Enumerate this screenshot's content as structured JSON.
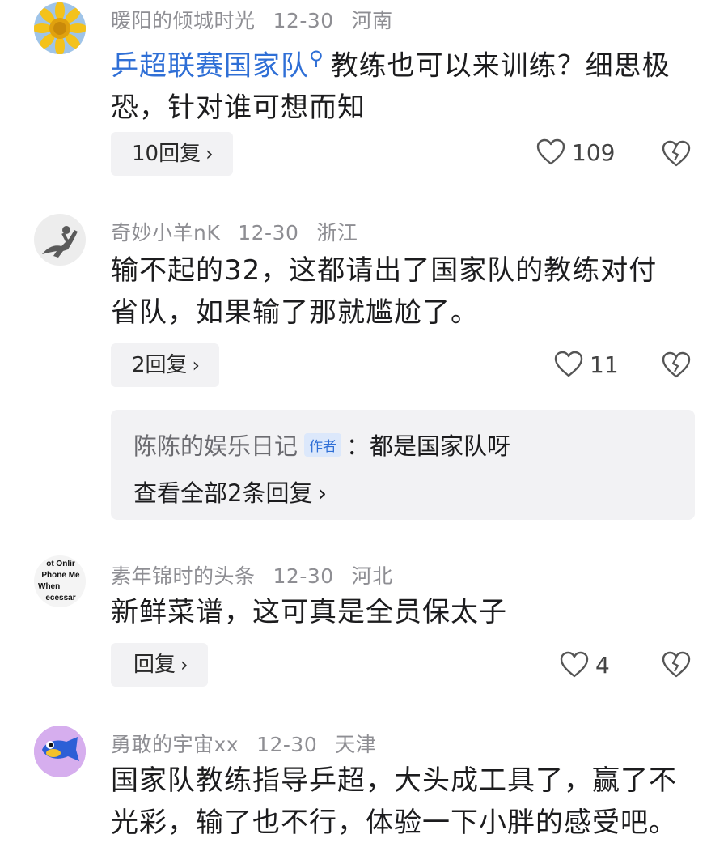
{
  "comments": [
    {
      "username": "暖阳的倾城时光",
      "date": "12-30",
      "location": "河南",
      "topic_link": "乒超联赛国家队",
      "topic_icon": "search-icon",
      "text": "教练也可以来训练？细思极恐，针对谁可想而知",
      "reply_label": "10回复",
      "like_count": "109",
      "avatar": "sunflower"
    },
    {
      "username": "奇妙小羊nK",
      "date": "12-30",
      "location": "浙江",
      "text": "输不起的32，这都请出了国家队的教练对付省队，如果输了那就尴尬了。",
      "reply_label": "2回复",
      "like_count": "11",
      "avatar": "horse-rider-sketch",
      "sub_reply": {
        "author": "陈陈的娱乐日记",
        "author_tag": "作者",
        "text": "：都是国家队呀",
        "view_all": "查看全部2条回复"
      }
    },
    {
      "username": "素年锦时的头条",
      "date": "12-30",
      "location": "河北",
      "text": "新鲜菜谱，这可真是全员保太子",
      "reply_label": "回复",
      "like_count": "4",
      "avatar": "text-avatar",
      "avatar_text": [
        "ot Onlir",
        "Phone Me",
        "When",
        "ecessar"
      ]
    },
    {
      "username": "勇敢的宇宙xx",
      "date": "12-30",
      "location": "天津",
      "text": "国家队教练指导乒超，大头成工具了，赢了不光彩，输了也不行，体验一下小胖的感受吧。",
      "avatar": "cartoon-fish"
    }
  ],
  "chevron": "›",
  "colors": {
    "link": "#2f6fd6",
    "meta": "#8e8e93",
    "button_bg": "#f2f2f4"
  }
}
